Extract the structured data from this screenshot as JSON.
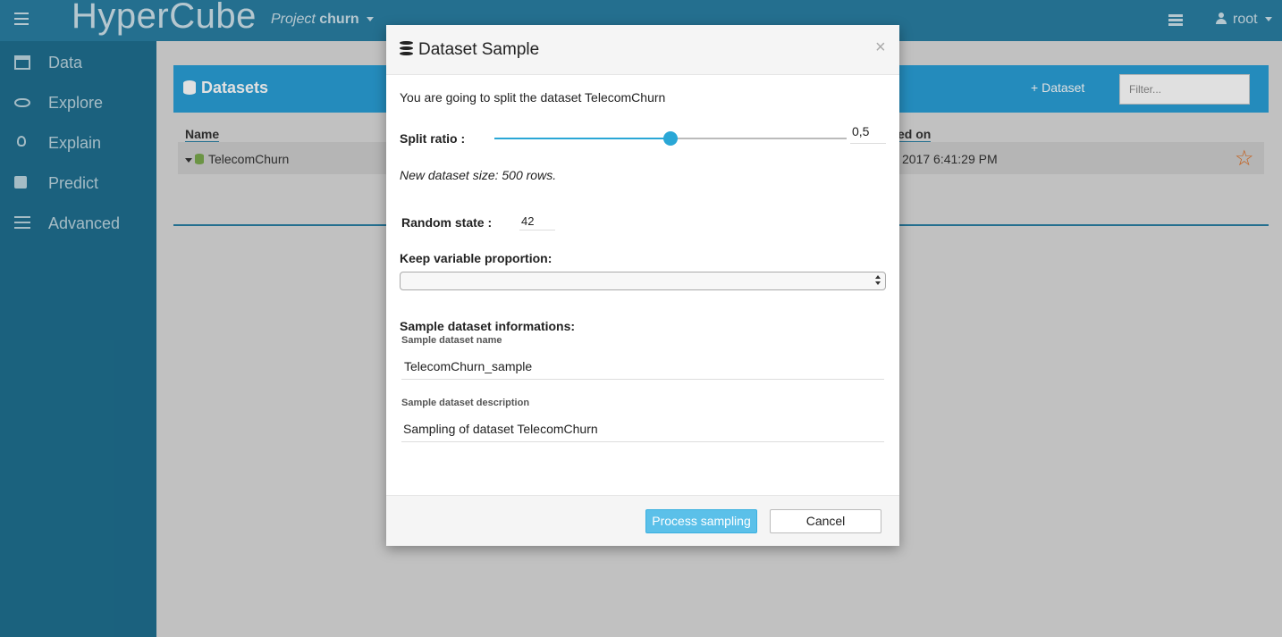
{
  "topbar": {
    "brand": "HyperCube",
    "project_prefix": "Project",
    "project_name": "churn",
    "user": "root",
    "menu_icon": "hamburger-icon",
    "layout_icon": "list-icon",
    "user_icon": "user-icon"
  },
  "sidebar": {
    "items": [
      {
        "label": "Data",
        "icon": "archive-icon"
      },
      {
        "label": "Explore",
        "icon": "eye-icon"
      },
      {
        "label": "Explain",
        "icon": "lightbulb-icon"
      },
      {
        "label": "Predict",
        "icon": "puzzle-icon"
      },
      {
        "label": "Advanced",
        "icon": "sliders-icon"
      }
    ]
  },
  "datasets_panel": {
    "title": "Datasets",
    "add_label": "Dataset",
    "filter_placeholder": "Filter...",
    "columns": {
      "name": "Name",
      "created": "ed on"
    },
    "rows": [
      {
        "name": "TelecomChurn",
        "date": "2017 6:41:29 PM"
      }
    ],
    "colors": {
      "header": "#2a9fd6",
      "star": "#e06a1c"
    }
  },
  "modal": {
    "title": "Dataset Sample",
    "close": "×",
    "intro": "You are going to split the dataset TelecomChurn",
    "split_label": "Split ratio :",
    "split_value": "0,5",
    "split_fraction": 0.5,
    "new_size": "New dataset size: 500 rows.",
    "random_state_label": "Random state :",
    "random_state_value": "42",
    "keep_proportion_label": "Keep variable proportion:",
    "keep_proportion_selected": "",
    "info_label": "Sample dataset informations:",
    "name_label": "Sample dataset name",
    "name_value": "TelecomChurn_sample",
    "desc_label": "Sample dataset description",
    "desc_value": "Sampling of dataset TelecomChurn",
    "process_button": "Process sampling",
    "cancel_button": "Cancel",
    "accent_color": "#5bc0e9"
  }
}
